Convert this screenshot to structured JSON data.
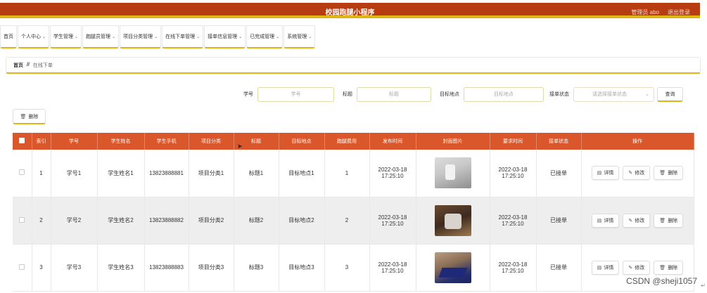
{
  "header": {
    "title": "校园跑腿小程序",
    "user_label": "管理员 abo",
    "logout_label": "退出登录",
    "bg_color": "#b83c12",
    "accent_color": "#e0b415"
  },
  "nav": {
    "items": [
      {
        "label": "首页",
        "dropdown": false
      },
      {
        "label": "个人中心",
        "dropdown": true
      },
      {
        "label": "学生管理",
        "dropdown": true
      },
      {
        "label": "跑腿员管理",
        "dropdown": true
      },
      {
        "label": "项目分类管理",
        "dropdown": true
      },
      {
        "label": "在线下单管理",
        "dropdown": true
      },
      {
        "label": "接单信息管理",
        "dropdown": true
      },
      {
        "label": "已完成管理",
        "dropdown": true
      },
      {
        "label": "系统管理",
        "dropdown": true
      }
    ]
  },
  "breadcrumb": {
    "home": "首页",
    "separator": "//",
    "current": "在线下单"
  },
  "search": {
    "student_no_label": "学号",
    "student_no_placeholder": "学号",
    "title_label": "标题",
    "title_placeholder": "标题",
    "target_label": "目标地点",
    "target_placeholder": "目标地点",
    "status_label": "接单状态",
    "status_placeholder": "请选择接单状态",
    "search_button": "查询"
  },
  "toolbar": {
    "delete_label": "删除"
  },
  "table": {
    "header_color": "#d9572b",
    "columns": [
      "索引",
      "学号",
      "学生姓名",
      "学生手机",
      "项目分类",
      "标题",
      "目标地点",
      "跑腿费用",
      "发布时间",
      "封面图片",
      "要求时间",
      "接单状态",
      "操作"
    ],
    "rows": [
      {
        "index": "1",
        "student_no": "学号1",
        "student_name": "学生姓名1",
        "phone": "13823888881",
        "category": "项目分类1",
        "title": "标题1",
        "target": "目标地点1",
        "fee": "1",
        "publish_time": "2022-03-18 17:25:10",
        "require_time": "2022-03-18 17:25:10",
        "status": "已接单"
      },
      {
        "index": "2",
        "student_no": "学号2",
        "student_name": "学生姓名2",
        "phone": "13823888882",
        "category": "项目分类2",
        "title": "标题2",
        "target": "目标地点2",
        "fee": "2",
        "publish_time": "2022-03-18 17:25:10",
        "require_time": "2022-03-18 17:25:10",
        "status": "已接单"
      },
      {
        "index": "3",
        "student_no": "学号3",
        "student_name": "学生姓名3",
        "phone": "13823888883",
        "category": "项目分类3",
        "title": "标题3",
        "target": "目标地点3",
        "fee": "3",
        "publish_time": "2022-03-18 17:25:10",
        "require_time": "2022-03-18 17:25:10",
        "status": "已接单"
      }
    ],
    "ops": {
      "detail": "详情",
      "edit": "修改",
      "delete": "删除"
    }
  },
  "watermark": "CSDN @sheji1057"
}
